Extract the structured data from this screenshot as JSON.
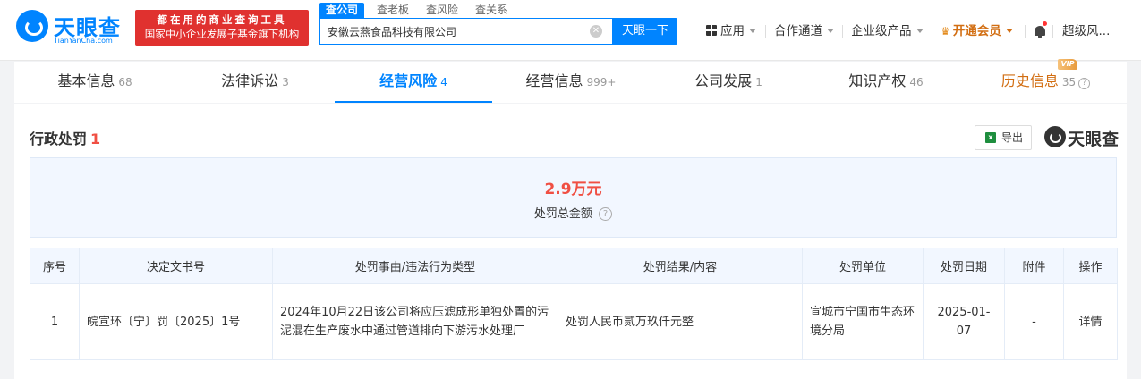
{
  "brand": {
    "name": "天眼查",
    "domain": "TianYanCha.com",
    "promo_line1": "都在用的商业查询工具",
    "promo_line2": "国家中小企业发展子基金旗下机构"
  },
  "search": {
    "tabs": [
      "查公司",
      "查老板",
      "查风险",
      "查关系"
    ],
    "active_tab": "查公司",
    "value": "安徽云燕食品科技有限公司",
    "button": "天眼一下"
  },
  "nav": {
    "apps": "应用",
    "channels": "合作通道",
    "enterprise": "企业级产品",
    "vip": "开通会员",
    "user": "超级风..."
  },
  "tabs": [
    {
      "label": "基本信息",
      "count": "68"
    },
    {
      "label": "法律诉讼",
      "count": "3"
    },
    {
      "label": "经营风险",
      "count": "4"
    },
    {
      "label": "经营信息",
      "count": "999+"
    },
    {
      "label": "公司发展",
      "count": "1"
    },
    {
      "label": "知识产权",
      "count": "46"
    },
    {
      "label": "历史信息",
      "count": "35",
      "badge": "VIP"
    }
  ],
  "section": {
    "title": "行政处罚",
    "count": "1",
    "export": "导出",
    "watermark": "天眼查"
  },
  "summary": {
    "amount": "2.9万元",
    "label": "处罚总金额"
  },
  "table": {
    "headers": [
      "序号",
      "决定文书号",
      "处罚事由/违法行为类型",
      "处罚结果/内容",
      "处罚单位",
      "处罚日期",
      "附件",
      "操作"
    ],
    "rows": [
      {
        "index": "1",
        "doc_no": "皖宣环〔宁〕罚〔2025〕1号",
        "reason": "2024年10月22日该公司将应压滤成形单独处置的污泥混在生产废水中通过管道排向下游污水处理厂",
        "result": "处罚人民币贰万玖仟元整",
        "unit": "宣城市宁国市生态环境分局",
        "date": "2025-01-07",
        "attachment": "-",
        "action": "详情"
      }
    ]
  }
}
